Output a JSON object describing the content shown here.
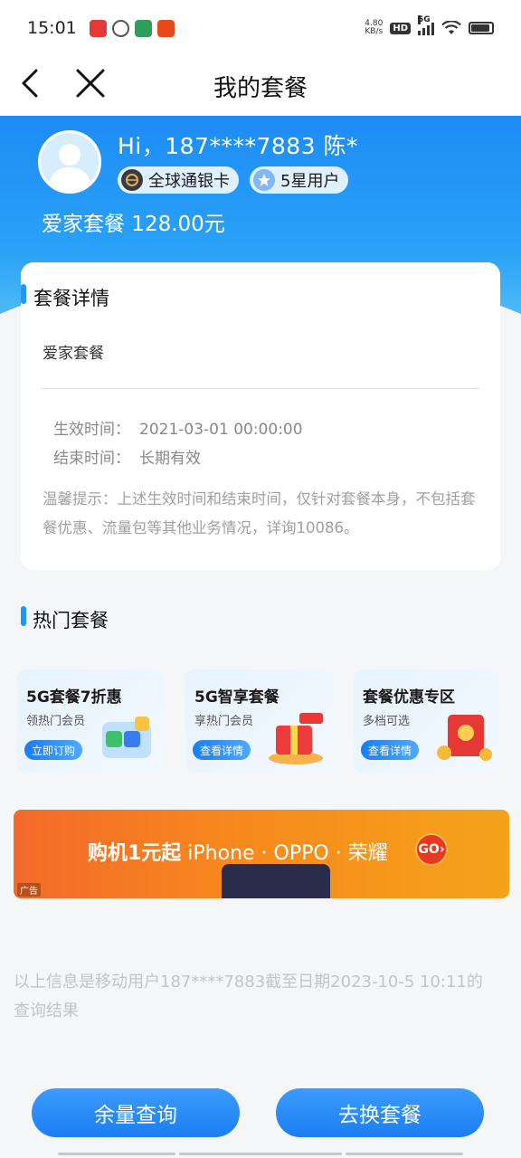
{
  "status_bar": {
    "time": "15:01",
    "net_speed_value": "4.80",
    "net_speed_unit": "KB/s",
    "hd": "HD",
    "network": "5G"
  },
  "nav": {
    "title": "我的套餐"
  },
  "user": {
    "greeting": "Hi，187****7883 陈*",
    "badge_card": "全球通银卡",
    "badge_star": "5星用户",
    "plan_summary": "爱家套餐 128.00元"
  },
  "detail": {
    "section_title": "套餐详情",
    "plan_name": "爱家套餐",
    "start_label": "生效时间：",
    "start_value": "2021-03-01 00:00:00",
    "end_label": "结束时间：",
    "end_value": "长期有效",
    "tip": "温馨提示：上述生效时间和结束时间，仅针对套餐本身，不包括套餐优惠、流量包等其他业务情况，详询10086。"
  },
  "hot": {
    "section_title": "热门套餐",
    "items": [
      {
        "title": "5G套餐7折惠",
        "subtitle": "领热门会员",
        "button": "立即订购"
      },
      {
        "title": "5G智享套餐",
        "subtitle": "享热门会员",
        "button": "查看详情"
      },
      {
        "title": "套餐优惠专区",
        "subtitle": "多档可选",
        "button": "查看详情"
      }
    ]
  },
  "ad": {
    "text_bold": "购机1元起",
    "text_rest": " iPhone · OPPO · 荣耀",
    "go": "GO",
    "label": "广告"
  },
  "footer_note": "以上信息是移动用户187****7883截至日期2023-10-5 10:11的查询结果",
  "buttons": {
    "balance_query": "余量查询",
    "change_plan": "去换套餐"
  },
  "colors": {
    "accent": "#1c7ef0",
    "hero_top": "#1d8cf6",
    "ad_orange": "#f36a2a"
  }
}
